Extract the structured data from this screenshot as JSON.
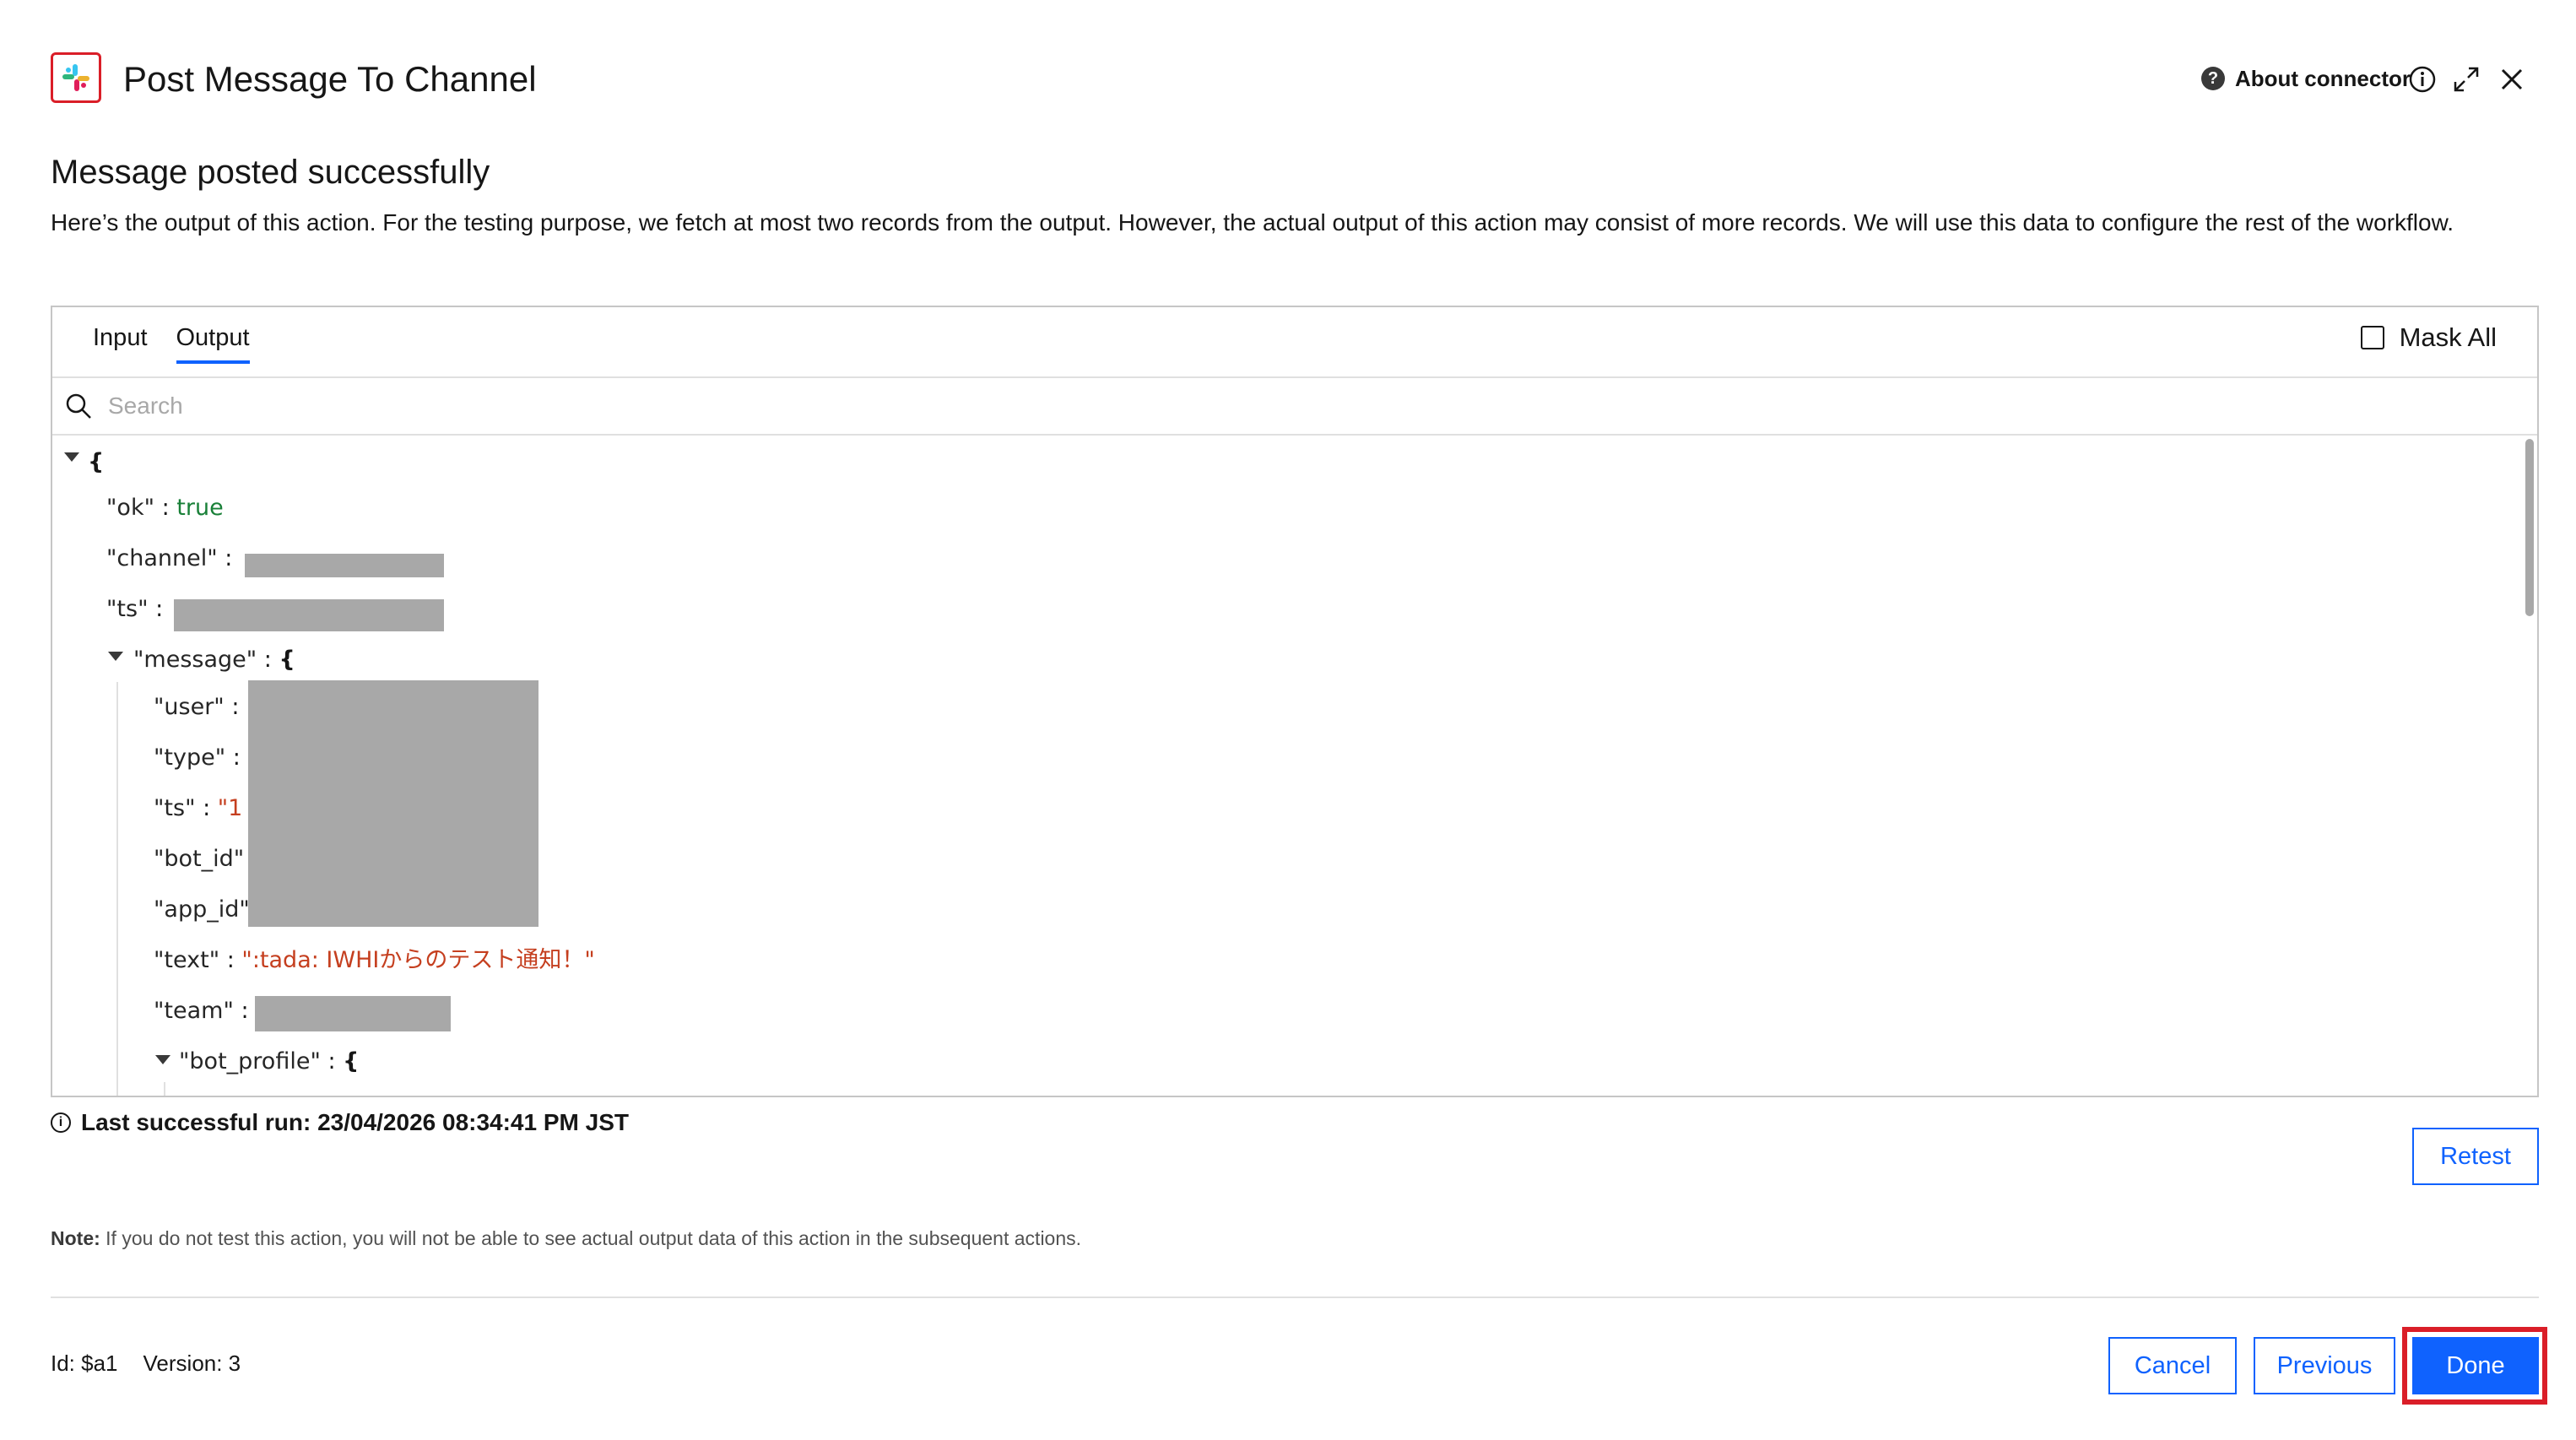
{
  "header": {
    "title": "Post Message To Channel",
    "about_label": "About connector",
    "about_icon": "?",
    "app_icon": "slack-icon"
  },
  "heading": "Message posted successfully",
  "description": "Here’s the output of this action. For the testing purpose, we fetch at most two records from the output. However, the actual output of this action may consist of more records. We will use this data to configure the rest of the workflow.",
  "tabs": [
    {
      "label": "Input",
      "active": false
    },
    {
      "label": "Output",
      "active": true
    }
  ],
  "mask_all_label": "Mask All",
  "search": {
    "placeholder": "Search",
    "value": ""
  },
  "tree": {
    "open_brace": "{",
    "rows": [
      {
        "key": "\"ok\"",
        "sep": " : ",
        "value": "true"
      },
      {
        "key": "\"channel\"",
        "sep": " : ",
        "value": ""
      },
      {
        "key": "\"ts\"",
        "sep": " : ",
        "value": ""
      },
      {
        "key": "\"message\"",
        "sep": " : ",
        "value": "{"
      },
      {
        "key": "\"user\"",
        "sep": " : ",
        "value": ""
      },
      {
        "key": "\"type\"",
        "sep": " : ",
        "value": ""
      },
      {
        "key": "\"ts\"",
        "sep": " : ",
        "value": "\"1"
      },
      {
        "key": "\"bot_id\"",
        "sep": "",
        "value": ""
      },
      {
        "key": "\"app_id\"",
        "sep": "",
        "value": ""
      },
      {
        "key": "\"text\"",
        "sep": " : ",
        "value": "\":tada: IWHIからのテスト通知！\""
      },
      {
        "key": "\"team\"",
        "sep": " : ",
        "value": ""
      },
      {
        "key": "\"bot_profile\"",
        "sep": " : ",
        "value": "{"
      }
    ]
  },
  "last_run": {
    "icon": "i",
    "text": "Last successful run: 23/04/2026 08:34:41 PM JST"
  },
  "buttons": {
    "retest": "Retest",
    "cancel": "Cancel",
    "previous": "Previous",
    "done": "Done"
  },
  "note": {
    "label": "Note:",
    "text": " If you do not test this action, you will not be able to see actual output data of this action in the subsequent actions."
  },
  "meta": {
    "id": "Id: $a1",
    "version": "Version: 3"
  },
  "colors": {
    "primary": "#0f62fe",
    "highlight": "#da1e28",
    "bool": "#198038",
    "string": "#c53f1f",
    "redacted": "#a8a8a8"
  }
}
